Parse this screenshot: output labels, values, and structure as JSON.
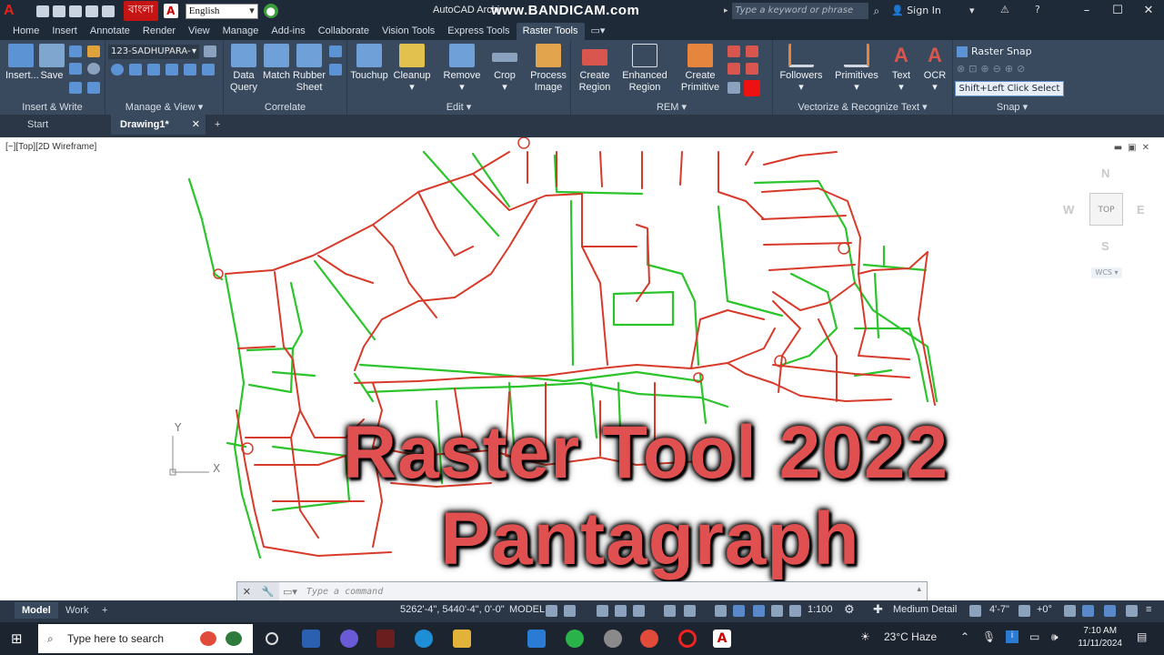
{
  "titlebar": {
    "app_letter": "A",
    "lang_badge": "বাংলা",
    "language": "English",
    "app_title": "AutoCAD Archi",
    "watermark": "www.BANDICAM.com",
    "search_placeholder": "Type a keyword or phrase",
    "sign_in": "Sign In"
  },
  "ribbon_tabs": [
    "Home",
    "Insert",
    "Annotate",
    "Render",
    "View",
    "Manage",
    "Add-ins",
    "Collaborate",
    "Vision Tools",
    "Express Tools",
    "Raster Tools"
  ],
  "active_tab": "Raster Tools",
  "ribbon": {
    "image_combo": "123-SADHUPARA-",
    "groups": {
      "insert_write": "Insert & Write",
      "manage_view": "Manage & View",
      "correlate": "Correlate",
      "edit": "Edit",
      "rem": "REM",
      "vectorize": "Vectorize & Recognize Text",
      "snap": "Snap"
    },
    "buttons": {
      "insert": "Insert...",
      "save": "Save",
      "data_query": [
        "Data",
        "Query"
      ],
      "match": "Match",
      "rubber_sheet": [
        "Rubber",
        "Sheet"
      ],
      "touchup": "Touchup",
      "cleanup": "Cleanup",
      "remove": "Remove",
      "crop": "Crop",
      "process_image": [
        "Process",
        "Image"
      ],
      "create_region": [
        "Create",
        "Region"
      ],
      "enhanced_region": [
        "Enhanced",
        "Region"
      ],
      "create_primitive": [
        "Create",
        "Primitive"
      ],
      "followers": "Followers",
      "primitives": "Primitives",
      "text": "Text",
      "ocr": "OCR",
      "raster_snap": "Raster Snap",
      "shift_select": "Shift+Left Click Select"
    }
  },
  "file_tabs": {
    "start": "Start",
    "drawing": "Drawing1*"
  },
  "viewport": {
    "label": "[−][Top][2D Wireframe]",
    "viewcube": {
      "n": "N",
      "s": "S",
      "e": "E",
      "w": "W",
      "top": "TOP",
      "wcs": "WCS"
    },
    "ucs_y": "Y",
    "ucs_x": "X"
  },
  "overlay": {
    "line1": "Raster Tool 2022",
    "line2": "Pantagraph"
  },
  "command": {
    "placeholder": "Type a command"
  },
  "layout_tabs": {
    "model": "Model",
    "work": "Work"
  },
  "statusbar": {
    "coords": "5262'-4\", 5440'-4\", 0'-0\"",
    "model": "MODEL",
    "scale": "1:100",
    "detail": "Medium Detail",
    "height": "4'-7\"",
    "plus": "+0°"
  },
  "taskbar": {
    "search": "Type here to search",
    "weather": "23°C  Haze",
    "time": "7:10 AM",
    "date": "11/11/2024"
  },
  "colors": {
    "trace_red": "#d83a2a",
    "trace_green": "#2bc42b",
    "overlay_red": "#e05050"
  }
}
